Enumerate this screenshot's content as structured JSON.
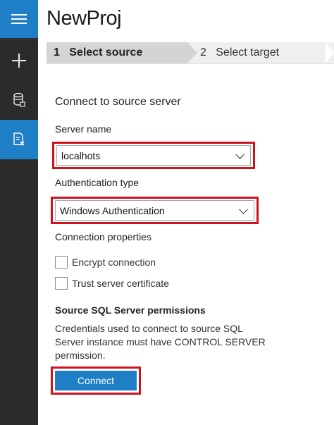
{
  "app": {
    "title": "NewProj"
  },
  "rail": {
    "items": [
      {
        "name": "menu",
        "icon": "hamburger-icon",
        "active": true
      },
      {
        "name": "new",
        "icon": "plus-icon",
        "active": false
      },
      {
        "name": "database",
        "icon": "database-icon",
        "active": false
      },
      {
        "name": "migration",
        "icon": "migration-icon",
        "active": true
      }
    ]
  },
  "wizard": {
    "steps": [
      {
        "number": "1",
        "label": "Select source",
        "active": true
      },
      {
        "number": "2",
        "label": "Select target",
        "active": false
      }
    ]
  },
  "form": {
    "section_title": "Connect to source server",
    "server_name": {
      "label": "Server name",
      "value": "localhots"
    },
    "auth_type": {
      "label": "Authentication type",
      "value": "Windows Authentication"
    },
    "connection_properties": {
      "label": "Connection properties",
      "options": [
        {
          "label": "Encrypt connection",
          "checked": false
        },
        {
          "label": "Trust server certificate",
          "checked": false
        }
      ]
    },
    "permissions": {
      "title": "Source SQL Server permissions",
      "text": "Credentials used to connect to source SQL Server instance must have CONTROL SERVER permission."
    },
    "connect_button": "Connect"
  },
  "colors": {
    "accent": "#1e7fc7",
    "highlight": "#d0121f",
    "rail": "#2b2b2b"
  }
}
